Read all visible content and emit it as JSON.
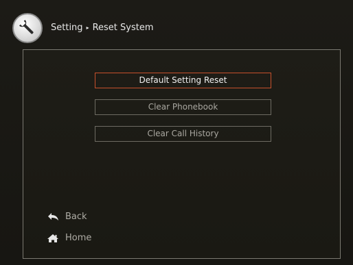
{
  "header": {
    "icon": "wrench-icon",
    "breadcrumb": [
      "Setting",
      "Reset System"
    ],
    "separator": "▸"
  },
  "menu": {
    "items": [
      {
        "label": "Default Setting Reset",
        "selected": true
      },
      {
        "label": "Clear Phonebook",
        "selected": false
      },
      {
        "label": "Clear Call History",
        "selected": false
      }
    ]
  },
  "nav": {
    "back": {
      "label": "Back",
      "icon": "back-arrow-icon"
    },
    "home": {
      "label": "Home",
      "icon": "home-icon"
    }
  },
  "colors": {
    "selected_border": "#c8512c",
    "panel_border": "#7c7a72",
    "background": "#1c1b16"
  }
}
